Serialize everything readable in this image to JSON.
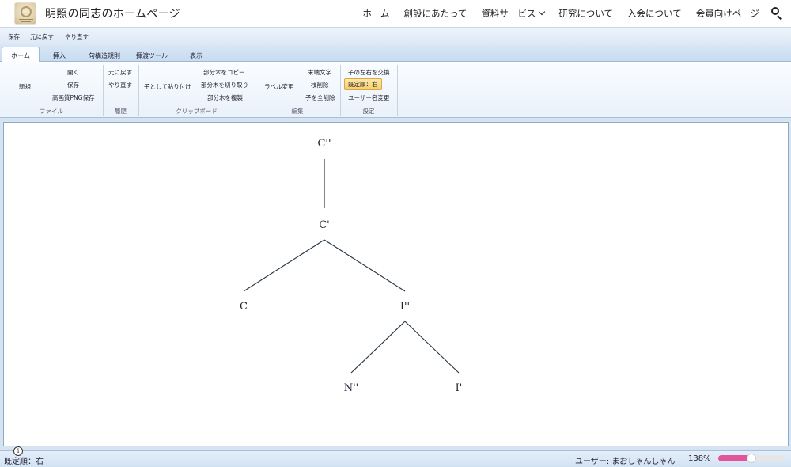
{
  "site": {
    "title": "明照の同志のホームページ",
    "nav": [
      "ホーム",
      "創設にあたって",
      "資料サービス",
      "研究について",
      "入会について",
      "会員向けページ"
    ]
  },
  "quick_access": [
    "保存",
    "元に戻す",
    "やり直す"
  ],
  "tabs": [
    "ホーム",
    "挿入",
    "句構造規則",
    "揮渡ツール",
    "表示"
  ],
  "ribbon": {
    "file": {
      "new": "新規",
      "open": "開く",
      "save": "保存",
      "save_png": "高画質PNG保存",
      "label": "ファイル"
    },
    "history": {
      "undo": "元に戻す",
      "redo": "やり直す",
      "label": "履歴"
    },
    "clipboard": {
      "paste_child": "子として貼り付け",
      "copy_subtree": "部分木をコピー",
      "cut_subtree": "部分木を切り取り",
      "duplicate_subtree": "部分木を複製",
      "label": "クリップボード"
    },
    "edit": {
      "change_label": "ラベル変更",
      "terminal": "末端文字",
      "delete_node": "枝削除",
      "delete_children": "子を全削除",
      "label": "編集"
    },
    "settings": {
      "swap_children": "子の左右を交換",
      "default_order": "既定順：右",
      "change_username": "ユーザー名変更",
      "label": "設定"
    }
  },
  "tree": {
    "nodes": [
      "C''",
      "C'",
      "C",
      "I''",
      "N''",
      "I'"
    ]
  },
  "status": {
    "default_order": "既定順：右",
    "user": "ユーザー: まおしゃんしゃん",
    "zoom": "138%",
    "zoom_fraction": 0.5
  },
  "colors": {
    "accent": "#e3559a",
    "ribbon_highlight": "#f7cf6b"
  }
}
